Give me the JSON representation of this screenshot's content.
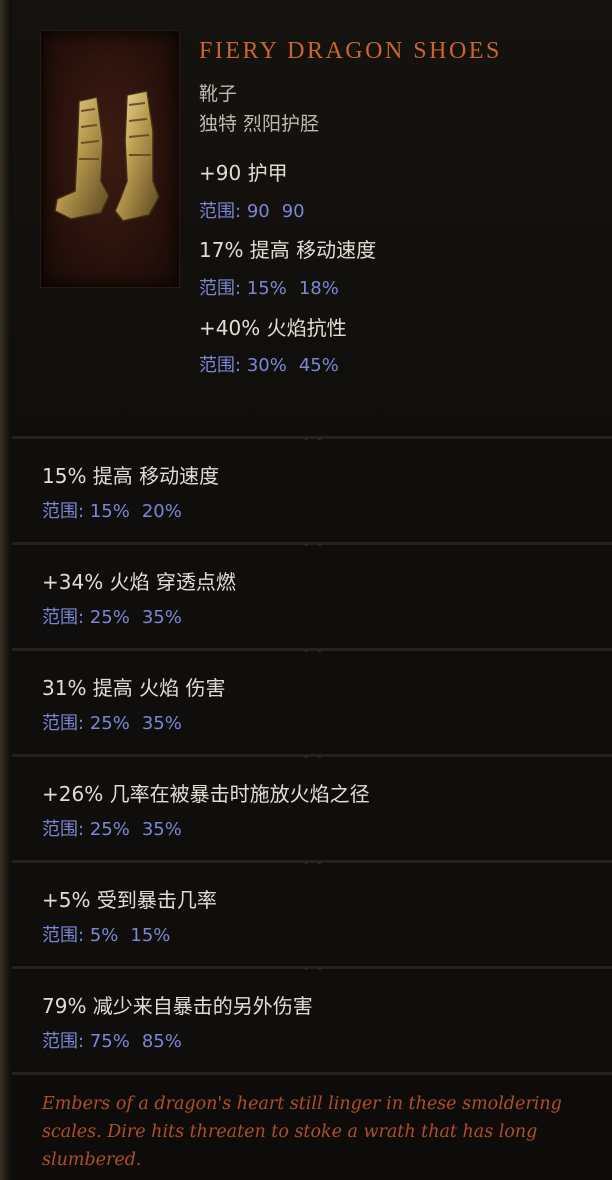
{
  "item": {
    "name": "FIERY DRAGON SHOES",
    "type": "靴子",
    "rarity": "独特 烈阳护胫",
    "icon": "golden-boots-icon"
  },
  "implicit_stats": [
    {
      "text": "+90 护甲",
      "range_label": "范围:",
      "min": "90",
      "max": "90"
    },
    {
      "text": "17% 提高 移动速度",
      "range_label": "范围:",
      "min": "15%",
      "max": "18%"
    },
    {
      "text": "+40% 火焰抗性",
      "range_label": "范围:",
      "min": "30%",
      "max": "45%"
    }
  ],
  "affixes": [
    {
      "text": "15% 提高 移动速度",
      "range_label": "范围:",
      "min": "15%",
      "max": "20%"
    },
    {
      "text": "+34% 火焰 穿透点燃",
      "range_label": "范围:",
      "min": "25%",
      "max": "35%"
    },
    {
      "text": "31% 提高 火焰 伤害",
      "range_label": "范围:",
      "min": "25%",
      "max": "35%"
    },
    {
      "text": "+26% 几率在被暴击时施放火焰之径",
      "range_label": "范围:",
      "min": "25%",
      "max": "35%"
    },
    {
      "text": "+5% 受到暴击几率",
      "range_label": "范围:",
      "min": "5%",
      "max": "15%"
    },
    {
      "text": "79% 减少来自暴击的另外伤害",
      "range_label": "范围:",
      "min": "75%",
      "max": "85%"
    }
  ],
  "flavor_text": "Embers of a dragon's heart still linger in these smoldering scales. Dire hits threaten to stoke a wrath that has long slumbered.",
  "colors": {
    "name": "#c9642d",
    "range": "#7c86d4",
    "flavor": "#b14e24"
  }
}
